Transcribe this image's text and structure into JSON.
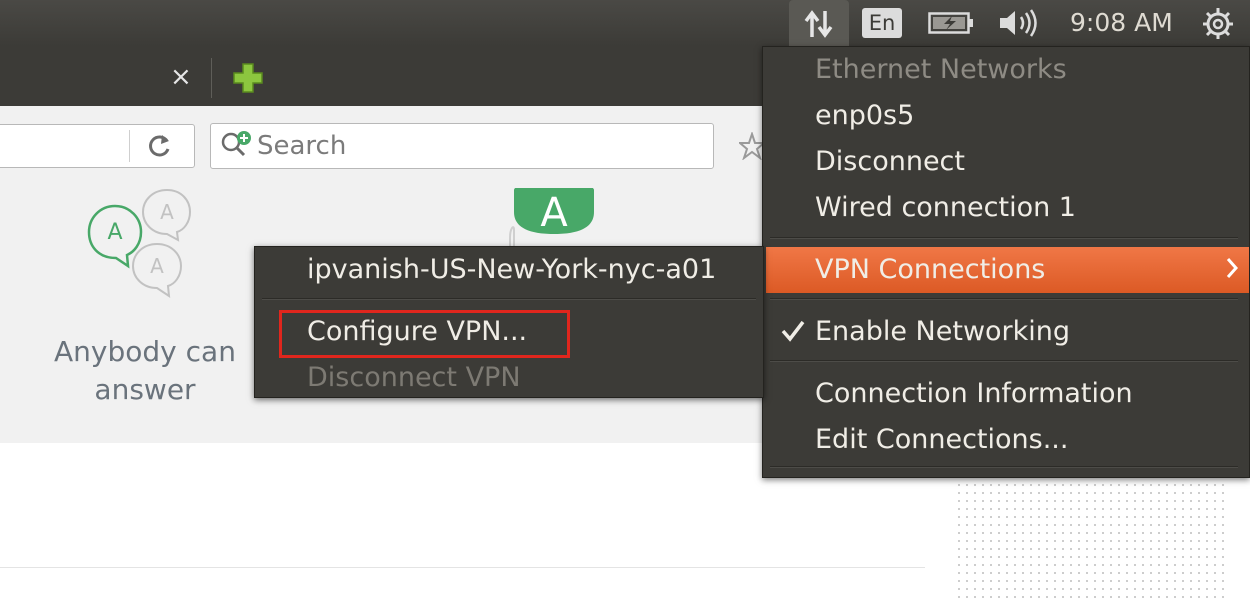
{
  "panel": {
    "language": "En",
    "clock": "9:08 AM",
    "icons": [
      "network-arrows-icon",
      "battery-charging-icon",
      "volume-icon",
      "power-gear-icon"
    ]
  },
  "browser": {
    "tab_close": "×",
    "search_placeholder": "Search",
    "icons": [
      "new-tab-plus-icon",
      "reload-icon",
      "search-icon",
      "bookmark-star-icon"
    ]
  },
  "page": {
    "caption": "Anybody can answer",
    "avatar_letter": "A"
  },
  "network_menu": {
    "ethernet_header": "Ethernet Networks",
    "interface": "enp0s5",
    "disconnect": "Disconnect",
    "wired_connection": "Wired connection 1",
    "vpn_connections": "VPN Connections",
    "enable_networking": "Enable Networking",
    "connection_information": "Connection Information",
    "edit_connections": "Edit Connections..."
  },
  "vpn_submenu": {
    "connection": "ipvanish-US-New-York-nyc-a01",
    "configure": "Configure VPN...",
    "disconnect": "Disconnect VPN"
  },
  "colors": {
    "panel_bg": "#3c3b37",
    "menu_text": "#f0ede6",
    "disabled_text": "#8e8b84",
    "highlight_orange": "#e8683a",
    "annotation_red": "#e0261d",
    "accent_green": "#48a868"
  }
}
